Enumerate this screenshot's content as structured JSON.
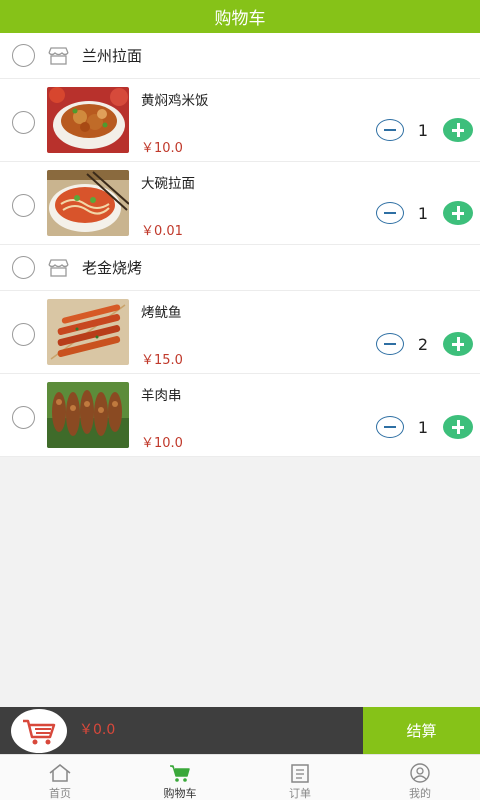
{
  "header": {
    "title": "购物车"
  },
  "shops": [
    {
      "name": "兰州拉面",
      "items": [
        {
          "name": "黄焖鸡米饭",
          "price": "￥10.0",
          "qty": "1"
        },
        {
          "name": "大碗拉面",
          "price": "￥0.01",
          "qty": "1"
        }
      ]
    },
    {
      "name": "老金烧烤",
      "items": [
        {
          "name": "烤鱿鱼",
          "price": "￥15.0",
          "qty": "2"
        },
        {
          "name": "羊肉串",
          "price": "￥10.0",
          "qty": "1"
        }
      ]
    }
  ],
  "checkout": {
    "total": "￥0.0",
    "button_label": "结算"
  },
  "tabs": [
    {
      "label": "首页",
      "icon": "home-icon"
    },
    {
      "label": "购物车",
      "icon": "cart-icon"
    },
    {
      "label": "订单",
      "icon": "order-icon"
    },
    {
      "label": "我的",
      "icon": "profile-icon"
    }
  ],
  "colors": {
    "brand_green": "#86c218",
    "price_red": "#c0392b",
    "plus_green": "#3dbf7b",
    "minus_blue": "#2e6fa3",
    "checkout_bar": "#3e3e3e"
  }
}
